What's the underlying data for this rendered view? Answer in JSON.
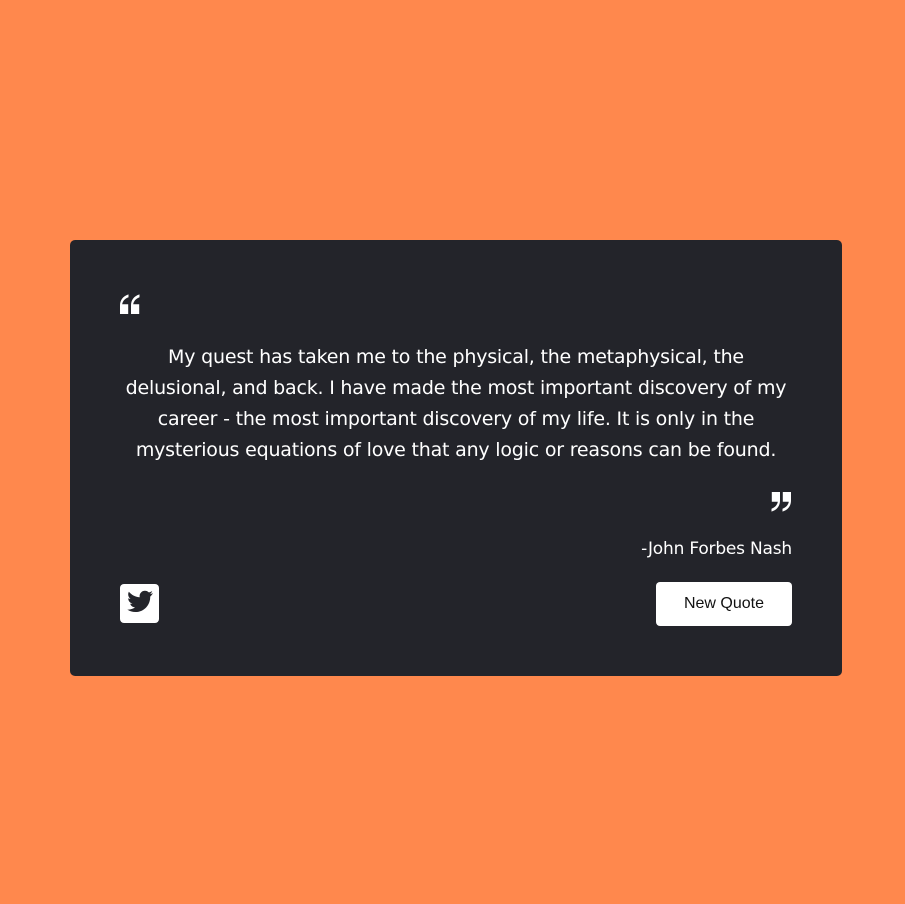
{
  "colors": {
    "background": "#ff884d",
    "card": "#23242a",
    "text": "#ffffff",
    "button_text": "#111111"
  },
  "quote": {
    "text": "My quest has taken me to the physical, the metaphysical, the delusional, and back. I have made the most important discovery of my career - the most important discovery of my life. It is only in the mysterious equations of love that any logic or reasons can be found.",
    "author": "-John Forbes Nash",
    "open_icon": "quote-left-icon",
    "close_icon": "quote-right-icon"
  },
  "actions": {
    "tweet_icon": "twitter-icon",
    "new_quote_label": "New Quote"
  }
}
